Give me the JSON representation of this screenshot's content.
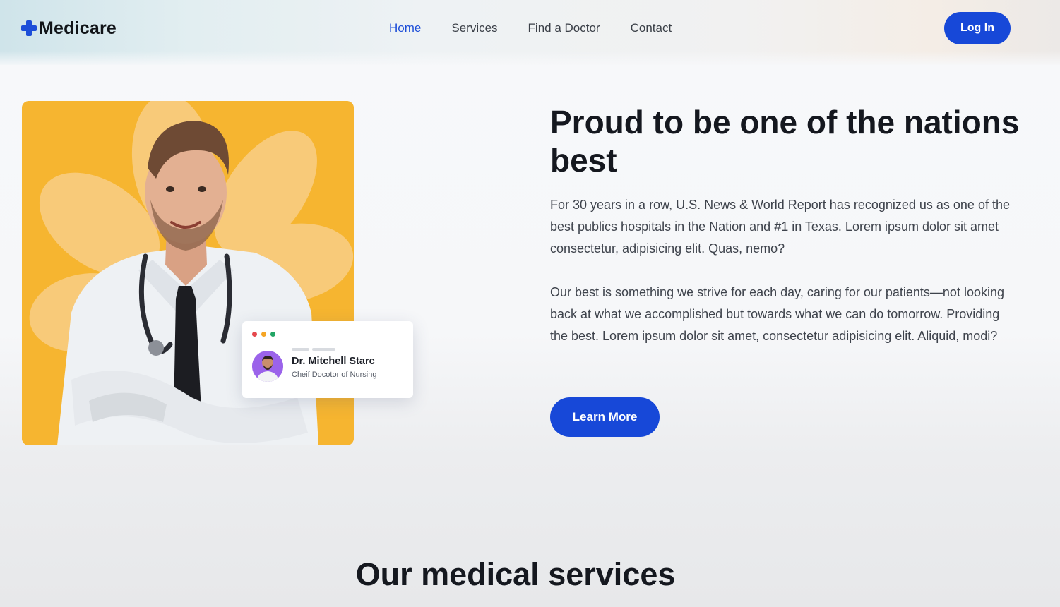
{
  "brand": {
    "name": "Medicare",
    "accent_color": "#1748d8",
    "icon": "plus-cross-icon"
  },
  "nav": {
    "items": [
      {
        "label": "Home",
        "active": true
      },
      {
        "label": "Services",
        "active": false
      },
      {
        "label": "Find a Doctor",
        "active": false
      },
      {
        "label": "Contact",
        "active": false
      }
    ]
  },
  "header": {
    "login_label": "Log In"
  },
  "hero": {
    "title": "Proud to be one of the nations best",
    "paragraphs": [
      "For 30 years in a row, U.S. News & World Report has recognized us as one of the best publics hospitals in the Nation and #1 in Texas. Lorem ipsum dolor sit amet consectetur, adipisicing elit. Quas, nemo?",
      "Our best is something we strive for each day, caring for our patients—not looking back at what we accomplished but towards what we can do tomorrow. Providing the best. Lorem ipsum dolor sit amet, consectetur adipisicing elit. Aliquid, modi?"
    ],
    "cta_label": "Learn More",
    "image": {
      "background_color": "#f6b530",
      "subject": "doctor-portrait"
    }
  },
  "doctor_card": {
    "name": "Dr. Mitchell Starc",
    "role": "Cheif Docotor of Nursing",
    "window_dot_colors": [
      "#e5484d",
      "#f5a524",
      "#22a565"
    ]
  },
  "services": {
    "title": "Our medical services"
  }
}
